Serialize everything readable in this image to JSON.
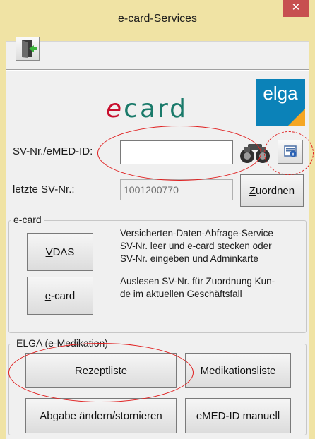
{
  "window": {
    "title": "e-card-Services",
    "close_glyph": "✕"
  },
  "toolbar": {
    "exit_icon": "door-exit-icon"
  },
  "logos": {
    "ecard_e": "e",
    "ecard_rest": "card",
    "elga": "elga"
  },
  "search": {
    "label": "SV-Nr./eMED-ID:",
    "value": "",
    "binoculars_icon": "binoculars-icon",
    "info_icon": "info-card-icon"
  },
  "last": {
    "label": "letzte SV-Nr.:",
    "value": "1001200770",
    "button_pre": "",
    "button_u": "Z",
    "button_post": "uordnen"
  },
  "ecard_group": {
    "title": "e-card",
    "vdas_u": "V",
    "vdas_post": "DAS",
    "vdas_desc": [
      "Versicherten-Daten-Abfrage-Service",
      "SV-Nr. leer und e-card stecken oder",
      "SV-Nr. eingeben und Adminkarte"
    ],
    "ecard_u": "e",
    "ecard_post": "-card",
    "ecard_desc": [
      "Auslesen SV-Nr. für Zuordnung Kun-",
      "de im aktuellen Geschäftsfall"
    ]
  },
  "elga_group": {
    "title": "ELGA (e-Medikation)",
    "rezeptliste": "Rezeptliste",
    "medikationsliste": "Medikationsliste",
    "abgabe": "Abgabe ändern/stornieren",
    "emed_manual": "eMED-ID manuell"
  },
  "colors": {
    "title_bar": "#f0e3a4",
    "close": "#c75050",
    "highlight_ring": "#e02020",
    "ecard_red": "#c8102e",
    "ecard_green": "#1a7a6a",
    "elga_blue": "#0b82b8",
    "elga_orange": "#f5a623"
  }
}
